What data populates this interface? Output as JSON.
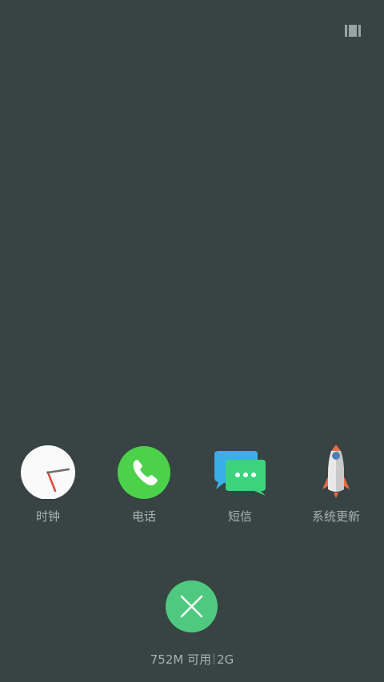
{
  "toolbar": {
    "view_toggle_icon": "multiwindow-icon"
  },
  "dock": {
    "apps": [
      {
        "label": "时钟",
        "icon": "clock-icon"
      },
      {
        "label": "电话",
        "icon": "phone-icon"
      },
      {
        "label": "短信",
        "icon": "messages-icon"
      },
      {
        "label": "系统更新",
        "icon": "rocket-icon"
      }
    ]
  },
  "actions": {
    "close_icon": "close-icon"
  },
  "memory": {
    "available": "752M 可用",
    "total": "2G"
  },
  "colors": {
    "background": "#374443",
    "close_button": "#4fc97f",
    "label_text": "#a9b2b1"
  }
}
